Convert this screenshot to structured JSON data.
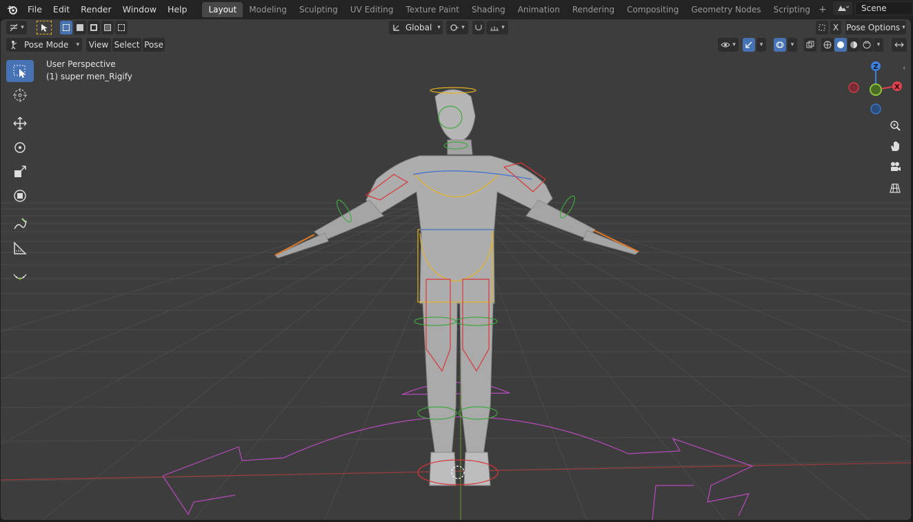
{
  "menu": [
    "File",
    "Edit",
    "Render",
    "Window",
    "Help"
  ],
  "workspaces": [
    "Layout",
    "Modeling",
    "Sculpting",
    "UV Editing",
    "Texture Paint",
    "Shading",
    "Animation",
    "Rendering",
    "Compositing",
    "Geometry Nodes",
    "Scripting"
  ],
  "active_workspace": "Layout",
  "scene": {
    "name": "Scene"
  },
  "header": {
    "transform_orientation": "Global",
    "pose_options": "Pose Options",
    "x_mirror": "X"
  },
  "header2": {
    "mode": "Pose Mode",
    "view": "View",
    "select": "Select",
    "pose": "Pose"
  },
  "viewport": {
    "perspective": "User Perspective",
    "object": "(1) super men_Rigify"
  },
  "gizmo": {
    "z": "Z",
    "x": "X"
  },
  "colors": {
    "accent": "#4772b3",
    "x_axis": "#e0414f",
    "y_axis": "#8bc43d",
    "z_axis": "#3c7fd8",
    "bone_yellow": "#e6b422",
    "bone_red": "#d73737",
    "bone_green": "#3ea83e",
    "bone_blue": "#3a6fcf",
    "root_magenta": "#b94bbd"
  },
  "toolbar_tools": [
    "select-box",
    "cursor",
    "move",
    "rotate",
    "scale",
    "transform",
    "annotate",
    "measure",
    "relax"
  ]
}
